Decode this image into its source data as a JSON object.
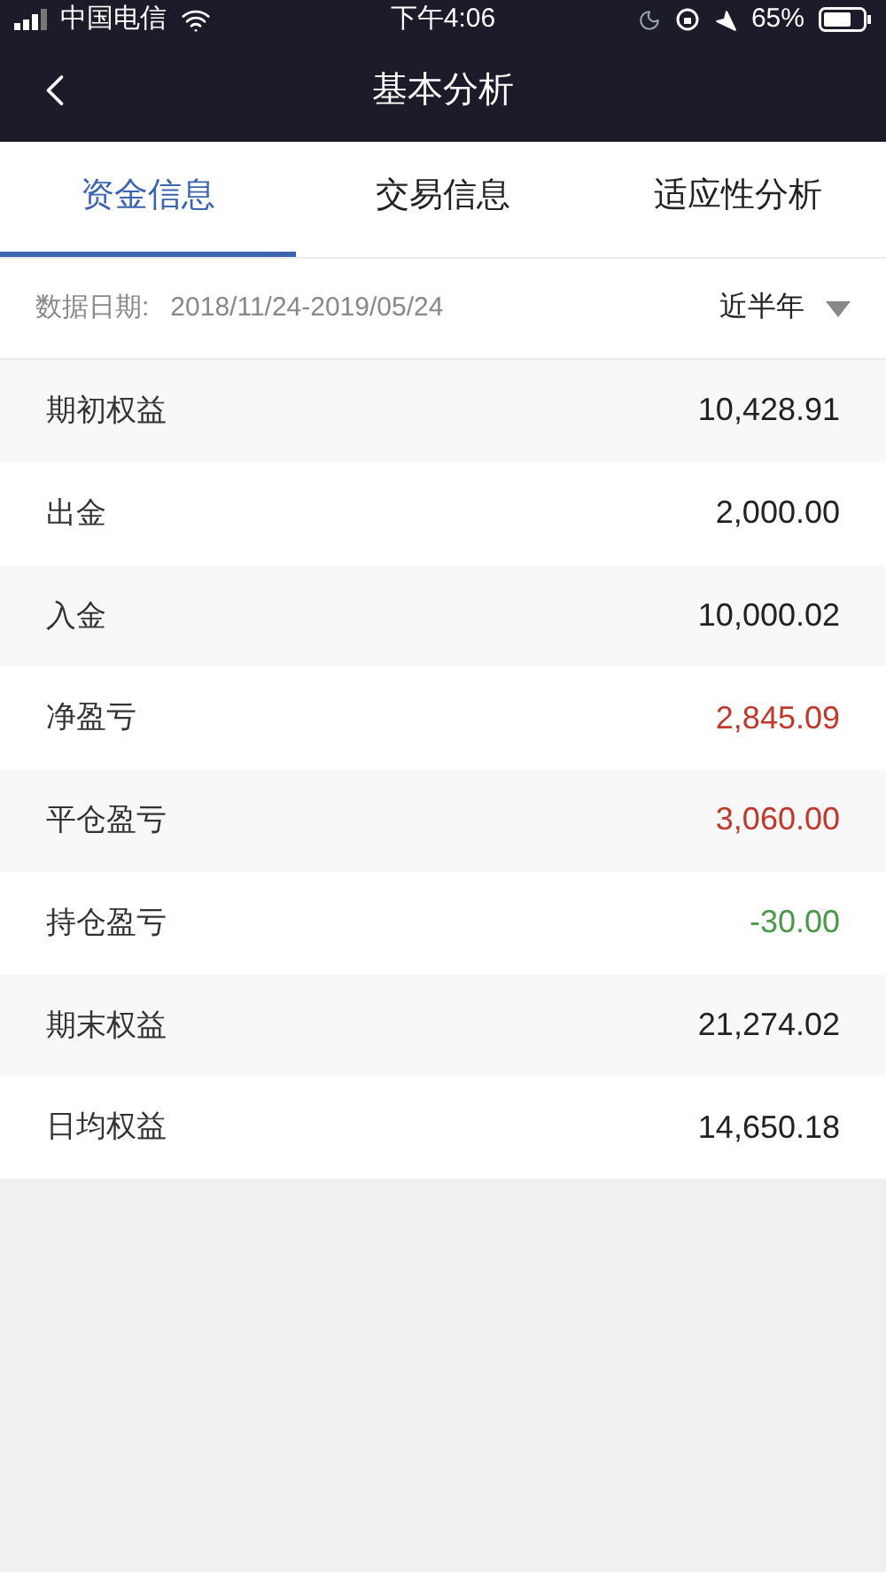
{
  "status_bar": {
    "carrier": "中国电信",
    "time": "下午4:06",
    "battery": "65%"
  },
  "nav": {
    "title": "基本分析"
  },
  "tabs": [
    {
      "label": "资金信息",
      "selected": true
    },
    {
      "label": "交易信息",
      "selected": false
    },
    {
      "label": "适应性分析",
      "selected": false
    }
  ],
  "filter": {
    "label": "数据日期:",
    "range": "2018/11/24-2019/05/24",
    "period": "近半年"
  },
  "rows": [
    {
      "label": "期初权益",
      "value": "10,428.91",
      "color": "#222222"
    },
    {
      "label": "出金",
      "value": "2,000.00",
      "color": "#222222"
    },
    {
      "label": "入金",
      "value": "10,000.02",
      "color": "#222222"
    },
    {
      "label": "净盈亏",
      "value": "2,845.09",
      "color": "#c0392b"
    },
    {
      "label": "平仓盈亏",
      "value": "3,060.00",
      "color": "#c0392b"
    },
    {
      "label": "持仓盈亏",
      "value": "-30.00",
      "color": "#4a9a4a"
    },
    {
      "label": "期末权益",
      "value": "21,274.02",
      "color": "#222222"
    },
    {
      "label": "日均权益",
      "value": "14,650.18",
      "color": "#222222"
    }
  ]
}
